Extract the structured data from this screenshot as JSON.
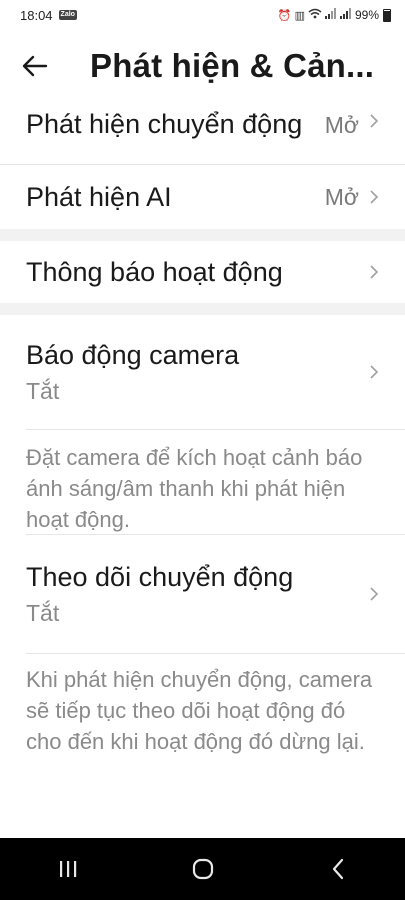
{
  "status_bar": {
    "time": "18:04",
    "app_badge": "Zalo",
    "battery": "99%"
  },
  "header": {
    "title": "Phát hiện & Cản..."
  },
  "settings": {
    "motion_detection": {
      "label": "Phát hiện chuyển động",
      "value": "Mở"
    },
    "ai_detection": {
      "label": "Phát hiện AI",
      "value": "Mở"
    },
    "activity_notification": {
      "label": "Thông báo hoạt động"
    },
    "camera_alarm": {
      "label": "Báo động camera",
      "status": "Tắt",
      "description": "Đặt camera để kích hoạt cảnh báo ánh sáng/âm thanh khi phát hiện hoạt động."
    },
    "motion_tracking": {
      "label": "Theo dõi chuyển động",
      "status": "Tắt",
      "description": "Khi phát hiện chuyển động, camera sẽ tiếp tục theo dõi hoạt động đó cho đến khi hoạt động đó dừng lại."
    }
  },
  "colors": {
    "text_primary": "#1a1a1a",
    "text_secondary": "#8a8a8a",
    "section_gap": "#f2f2f2",
    "navbar": "#000000"
  },
  "icons": {
    "back": "arrow-left-icon",
    "chevron": "chevron-right-icon",
    "recents": "recents-icon",
    "home": "home-icon",
    "nav_back": "nav-back-icon"
  }
}
